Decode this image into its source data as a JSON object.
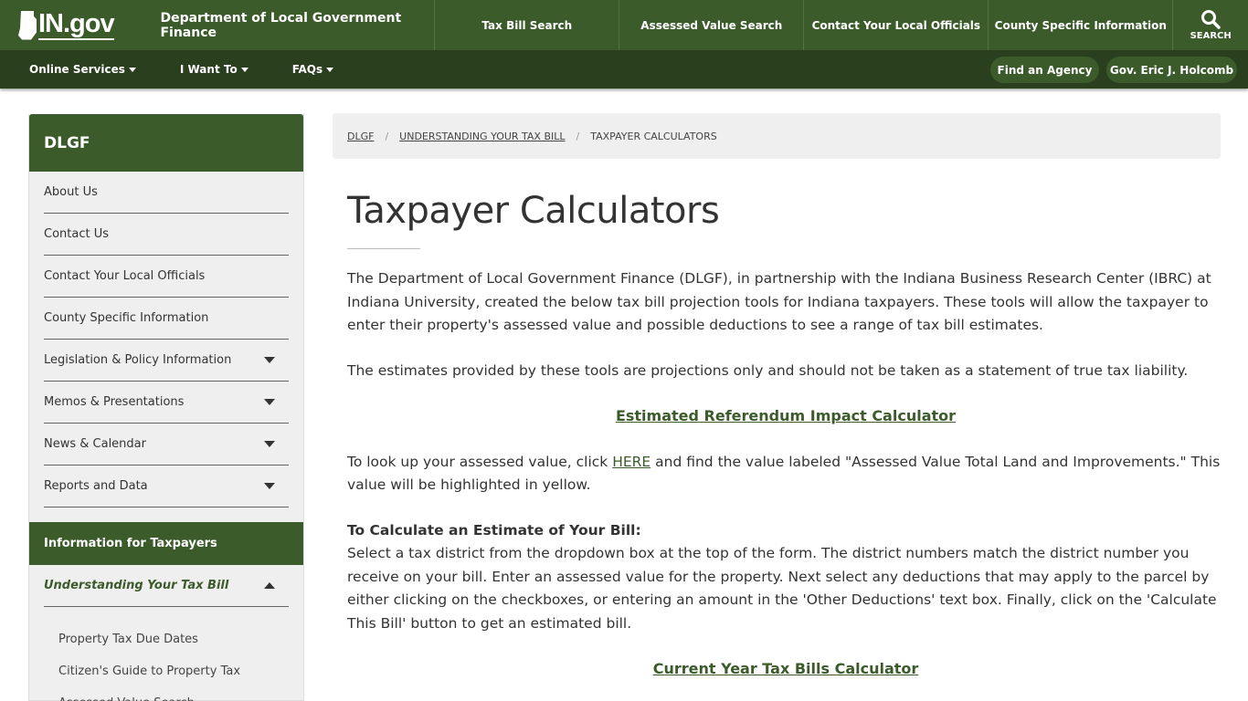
{
  "header": {
    "logo_text": "IN.gov",
    "agency_name": "Department of Local Government Finance",
    "nav": [
      "Tax Bill Search",
      "Assessed Value Search",
      "Contact Your Local Officials",
      "County Specific Information"
    ],
    "search_label": "SEARCH",
    "brand_color": "#3b5b2a"
  },
  "subnav": {
    "menus": [
      "Online Services",
      "I Want To",
      "FAQs"
    ],
    "find_agency": "Find an Agency",
    "governor": "Gov. Eric J. Holcomb"
  },
  "sidebar": {
    "title": "DLGF",
    "items": [
      {
        "label": "About Us",
        "expandable": false
      },
      {
        "label": "Contact Us",
        "expandable": false
      },
      {
        "label": "Contact Your Local Officials",
        "expandable": false
      },
      {
        "label": "County Specific Information",
        "expandable": false
      },
      {
        "label": "Legislation & Policy Information",
        "expandable": true
      },
      {
        "label": "Memos & Presentations",
        "expandable": true
      },
      {
        "label": "News & Calendar",
        "expandable": true
      },
      {
        "label": "Reports and Data",
        "expandable": true
      }
    ],
    "section": "Information for Taxpayers",
    "current": "Understanding Your Tax Bill",
    "sub_items": [
      "Property Tax Due Dates",
      "Citizen's Guide to Property Tax",
      "Assessed Value Search"
    ]
  },
  "breadcrumb": [
    "DLGF",
    "UNDERSTANDING YOUR TAX BILL",
    "TAXPAYER CALCULATORS"
  ],
  "main": {
    "title": "Taxpayer Calculators",
    "para1": "The Department of Local Government Finance (DLGF), in partnership with the Indiana Business Research Center (IBRC) at Indiana University, created the below tax bill projection tools for Indiana taxpayers. These tools will allow the taxpayer to enter their property's assessed value and possible deductions to see a range of tax bill estimates.",
    "para2": "The estimates provided by these tools are projections only and should not be taken as a statement of true tax liability.",
    "link1": "Estimated Referendum Impact Calculator",
    "para3_before": "To look up your assessed value, click ",
    "para3_link": "HERE",
    "para3_after": " and find the value labeled \"Assessed Value Total Land and Improvements.\" This value will be highlighted in yellow.",
    "calc_heading": "To Calculate an Estimate of Your Bill:",
    "para4": "Select a tax district from the dropdown box at the top of the form. The district numbers match the district number you receive on your bill. Enter an assessed value for the property. Next select any deductions that may apply to the parcel by either clicking on the checkboxes, or entering an amount in the 'Other Deductions' text box. Finally, click on the 'Calculate This Bill' button to get an estimated bill.",
    "link2": "Current Year Tax Bills Calculator"
  }
}
